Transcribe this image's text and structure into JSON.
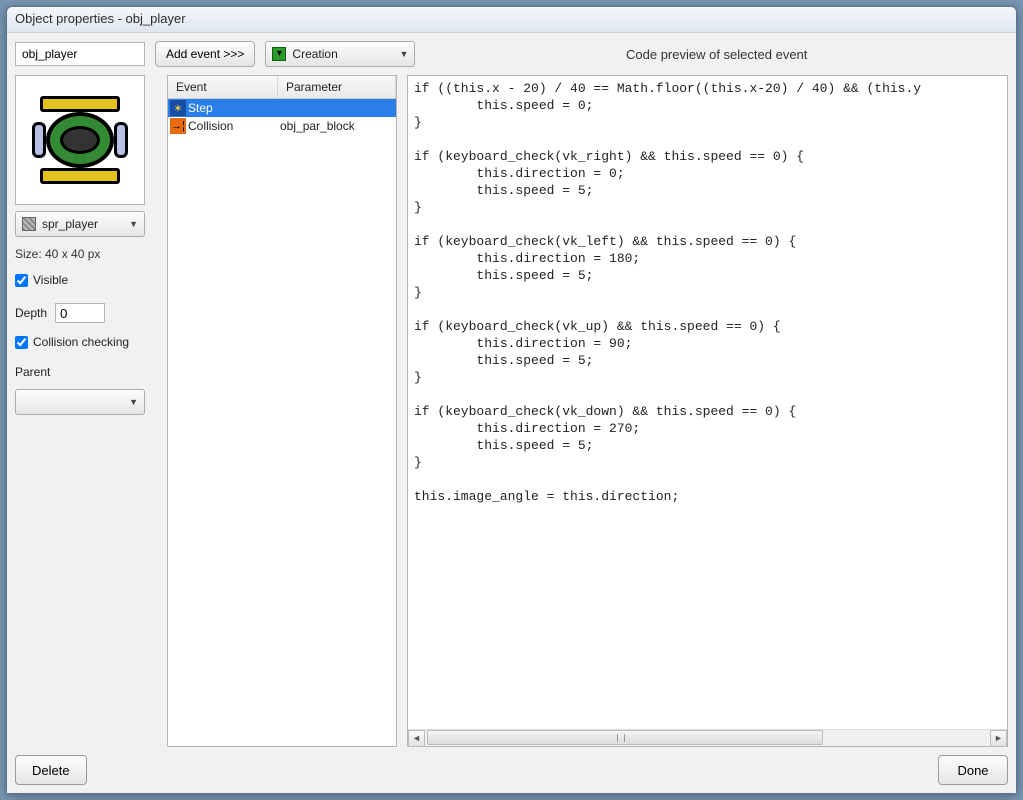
{
  "window": {
    "title": "Object properties - obj_player"
  },
  "toolbar": {
    "object_name": "obj_player",
    "add_event_label": "Add event >>>",
    "event_type_selected": "Creation"
  },
  "code_preview_heading": "Code preview of selected event",
  "left": {
    "sprite_selected": "spr_player",
    "size_label": "Size: 40 x 40 px",
    "visible_label": "Visible",
    "visible_checked": true,
    "depth_label": "Depth",
    "depth_value": "0",
    "collision_label": "Collision checking",
    "collision_checked": true,
    "parent_label": "Parent",
    "parent_value": ""
  },
  "events": {
    "columns": {
      "event": "Event",
      "parameter": "Parameter"
    },
    "rows": [
      {
        "icon": "step",
        "name": "Step",
        "parameter": "",
        "selected": true
      },
      {
        "icon": "coll",
        "name": "Collision",
        "parameter": "obj_par_block",
        "selected": false
      }
    ]
  },
  "code": "if ((this.x - 20) / 40 == Math.floor((this.x-20) / 40) && (this.y\n        this.speed = 0;\n}\n\nif (keyboard_check(vk_right) && this.speed == 0) {\n        this.direction = 0;\n        this.speed = 5;\n}\n\nif (keyboard_check(vk_left) && this.speed == 0) {\n        this.direction = 180;\n        this.speed = 5;\n}\n\nif (keyboard_check(vk_up) && this.speed == 0) {\n        this.direction = 90;\n        this.speed = 5;\n}\n\nif (keyboard_check(vk_down) && this.speed == 0) {\n        this.direction = 270;\n        this.speed = 5;\n}\n\nthis.image_angle = this.direction;",
  "buttons": {
    "delete": "Delete",
    "done": "Done"
  }
}
